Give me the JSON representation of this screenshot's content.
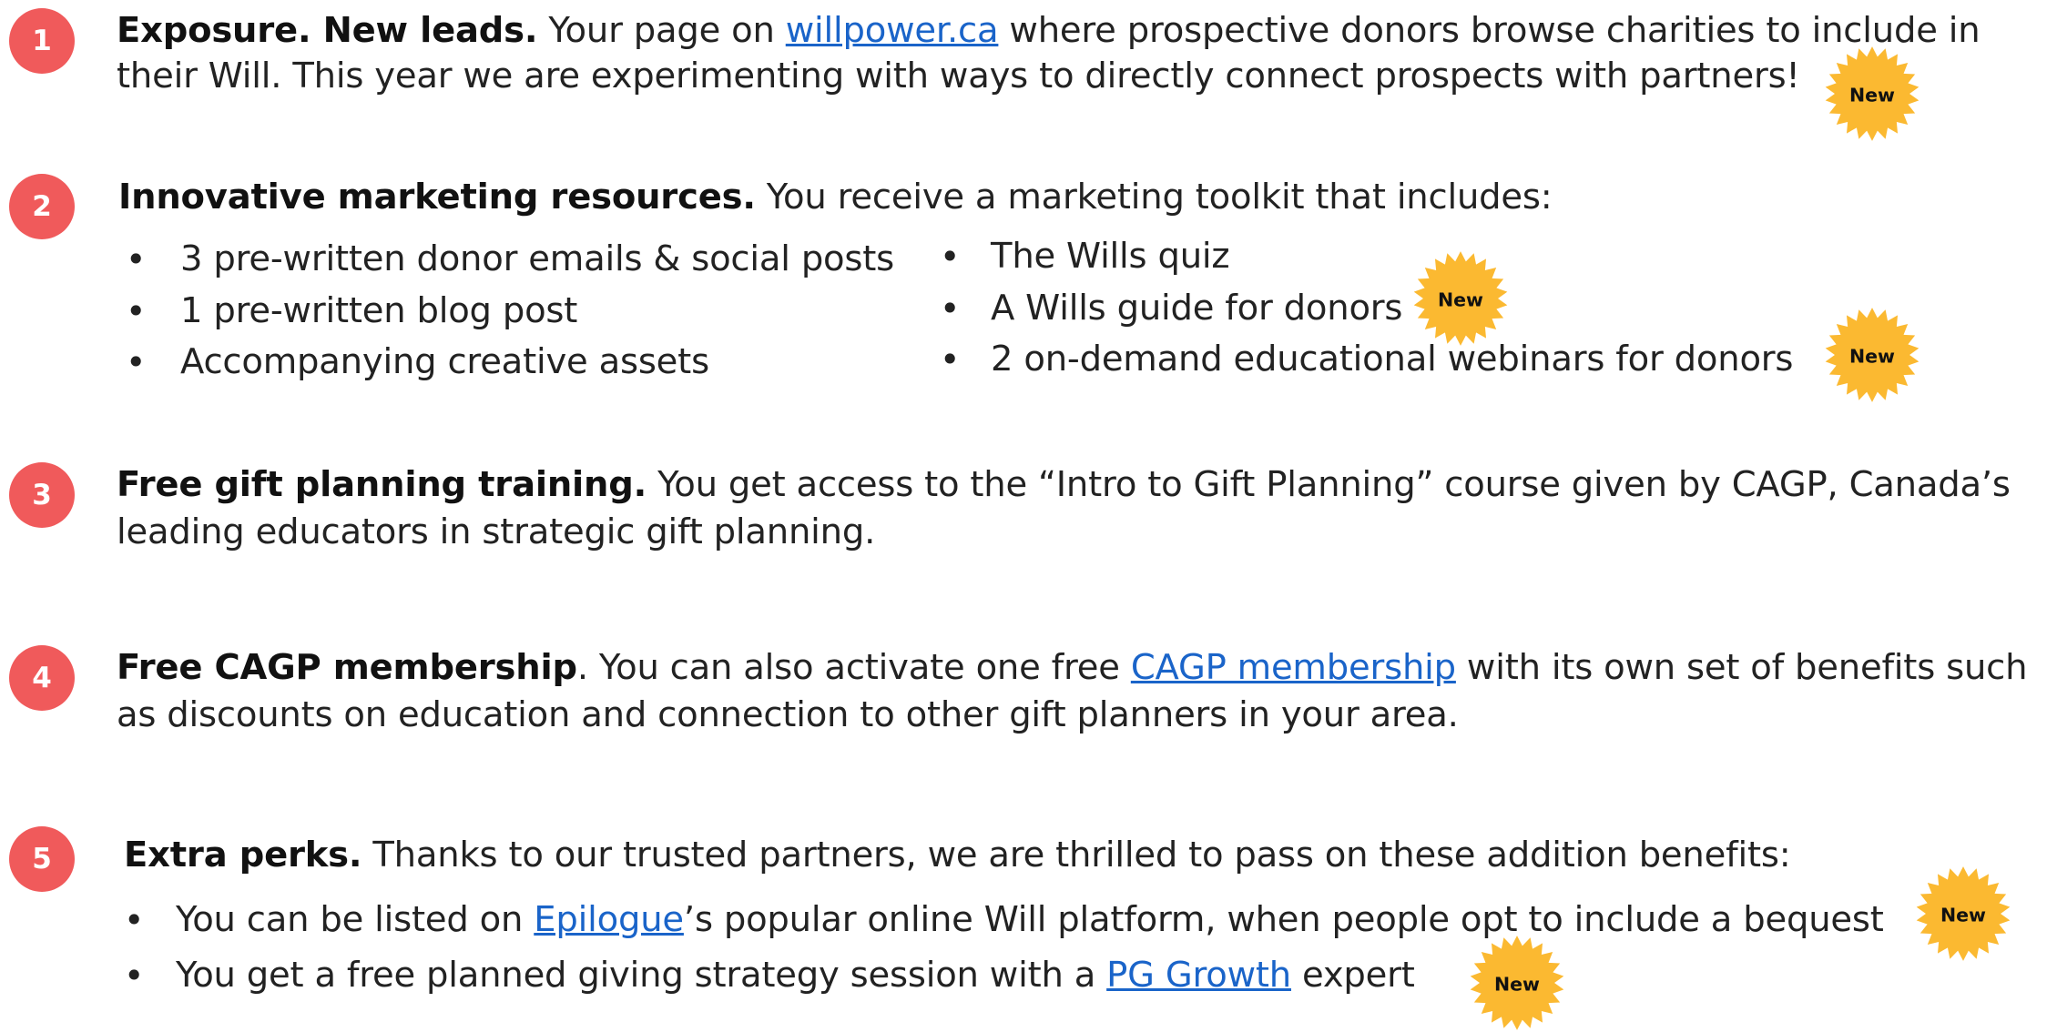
{
  "badge": {
    "label": "New",
    "color": "#fbb931",
    "text_color": "#111111"
  },
  "accent": {
    "number_bg": "#f05a5b",
    "link": "#1a64c9"
  },
  "items": [
    {
      "number": "1",
      "title": "Exposure. New leads.",
      "text_before": " Your page on ",
      "link": "willpower.ca",
      "text_after": " where prospective donors browse charities to include in",
      "line2": "their Will. This year we are experimenting with ways to directly connect prospects with partners!"
    },
    {
      "number": "2",
      "title": "Innovative marketing resources.",
      "text": " You receive a marketing toolkit that includes:",
      "left_bullets": [
        "3 pre-written donor emails & social posts",
        "1 pre-written blog post",
        "Accompanying creative assets"
      ],
      "right_bullets": [
        "The Wills quiz",
        "A Wills guide for donors",
        "2 on-demand educational webinars for donors"
      ]
    },
    {
      "number": "3",
      "title": "Free gift planning training.",
      "text": " You get access to the “Intro to Gift Planning” course given by CAGP, Canada’s",
      "line2": "leading educators in strategic gift planning."
    },
    {
      "number": "4",
      "title": "Free CAGP membership",
      "text_before": ". You can also activate one free ",
      "link": "CAGP membership",
      "text_after": " with its own set of benefits such",
      "line2": "as discounts on education and connection to other gift planners in your area."
    },
    {
      "number": "5",
      "title": "Extra perks.",
      "text": " Thanks to our trusted partners, we are thrilled to pass on these addition benefits:",
      "bullets": [
        {
          "before": "You can be listed on ",
          "link": "Epilogue",
          "after": "’s popular online Will platform, when people opt to include a bequest"
        },
        {
          "before": "You get a free planned giving strategy session with a ",
          "link": "PG Growth",
          "after": " expert"
        }
      ]
    }
  ]
}
